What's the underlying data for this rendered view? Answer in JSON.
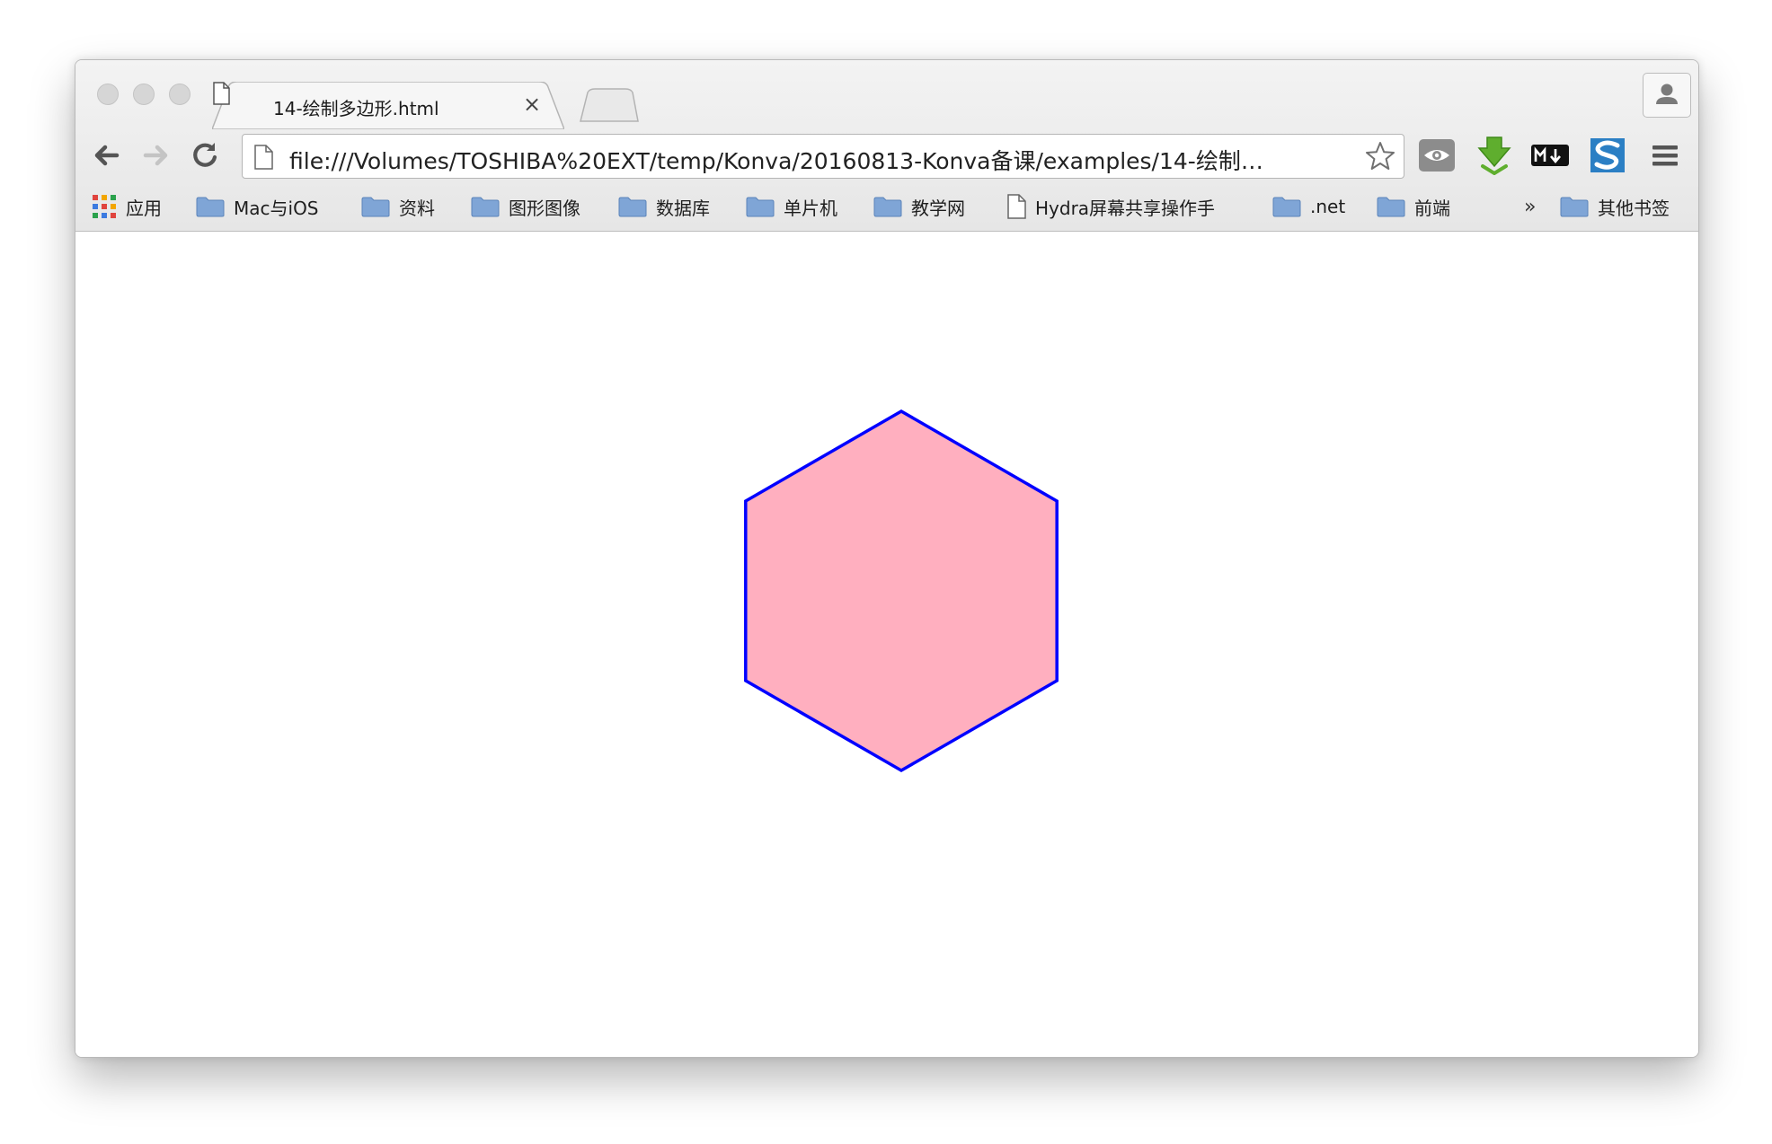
{
  "tab": {
    "title": "14-绘制多边形.html",
    "close_glyph": "×"
  },
  "address_bar": {
    "url": "file:///Volumes/TOSHIBA%20EXT/temp/Konva/20160813-Konva备课/examples/14-绘制…"
  },
  "bookmarks": {
    "apps_label": "应用",
    "items": [
      {
        "label": "Mac与iOS",
        "type": "folder"
      },
      {
        "label": "资料",
        "type": "folder"
      },
      {
        "label": "图形图像",
        "type": "folder"
      },
      {
        "label": "数据库",
        "type": "folder"
      },
      {
        "label": "单片机",
        "type": "folder"
      },
      {
        "label": "教学网",
        "type": "folder"
      },
      {
        "label": "Hydra屏幕共享操作手",
        "type": "page"
      },
      {
        "label": ".net",
        "type": "folder"
      },
      {
        "label": "前端",
        "type": "folder"
      }
    ],
    "overflow_glyph": "»",
    "other_label": "其他书签"
  },
  "extensions": [
    "eye-extension-icon",
    "download-arrow-extension-icon",
    "markdown-extension-icon",
    "s-logo-extension-icon"
  ],
  "canvas": {
    "shape": "regular-polygon",
    "sides": 6,
    "fill": "#ffafbf",
    "stroke": "#0000ff"
  }
}
